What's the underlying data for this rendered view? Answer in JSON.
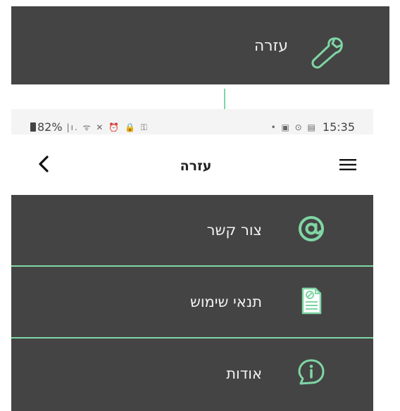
{
  "banner": {
    "label": "עזרה",
    "icon": "wrench-icon"
  },
  "status_bar": {
    "battery": "82%",
    "left_icons": "|ı. ᯤ ✕ ⏰ 🔒 ⚿",
    "right_icons": "• ▣ ⊙ ▤",
    "time": "15:35"
  },
  "app_bar": {
    "title": "עזרה",
    "back_icon": "chevron-left-icon",
    "menu_icon": "hamburger-menu-icon"
  },
  "menu": {
    "items": [
      {
        "label": "צור קשר",
        "icon": "at-sign-icon"
      },
      {
        "label": "תנאי שימוש",
        "icon": "document-icon"
      },
      {
        "label": "אודות",
        "icon": "info-bubble-icon"
      }
    ]
  },
  "colors": {
    "accent": "#7fd6a4",
    "panel": "#444444",
    "text_light": "#f2f2f2"
  }
}
